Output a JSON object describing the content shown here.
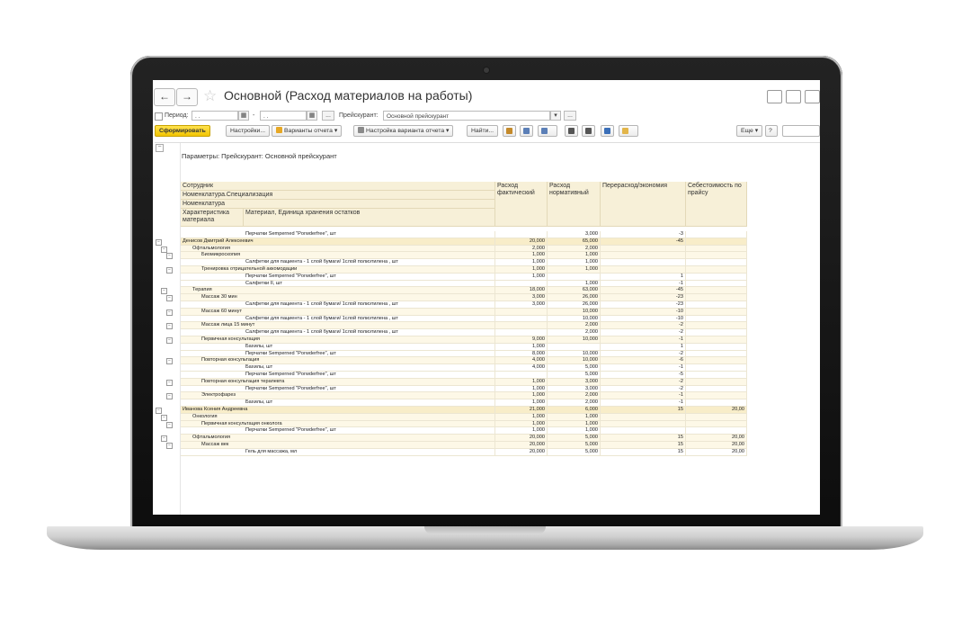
{
  "window": {
    "title": "Основной (Расход материалов на работы)",
    "back_label": "←",
    "forward_label": "→"
  },
  "filters": {
    "period_label": "Период:",
    "date_from": "  .  .",
    "date_to": "  .  .",
    "dash": "-",
    "more_button": "...",
    "pricelist_label": "Прейскурант:",
    "pricelist_value": "Основной прейскурант",
    "pricelist_dropdown": "▾",
    "pricelist_more": "..."
  },
  "toolbar": {
    "generate": "Сформировать",
    "settings": "Настройки...",
    "variants": "Варианты отчета",
    "variant_settings": "Настройка варианта отчета",
    "find": "Найти...",
    "more": "Еще",
    "help": "?"
  },
  "report": {
    "params_text": "Параметры:   Прейскурант: Основной прейскурант",
    "headers": {
      "employee": "Сотрудник",
      "specialization": "Номенклатура.Специализация",
      "nomenclature": "Номенклатура",
      "characteristic": "Характеристика материала",
      "material": "Материал, Единица хранения остатков",
      "actual": "Расход фактический",
      "normative": "Расход нормативный",
      "variance": "Перерасход/экономия",
      "cost": "Себестоимость по прайсу"
    },
    "rows": [
      {
        "level": 3,
        "name": "Перчатки Semperned \"Porwderfree\", шт",
        "actual": "",
        "normative": "3,000",
        "variance": "-3",
        "cost": ""
      },
      {
        "level": 0,
        "name": "Денисов Дмитрий Алексеевич",
        "actual": "20,000",
        "normative": "65,000",
        "variance": "-45",
        "cost": ""
      },
      {
        "level": 1,
        "name": "Офтальмология",
        "actual": "2,000",
        "normative": "2,000",
        "variance": "",
        "cost": ""
      },
      {
        "level": 2,
        "name": "Биомикроскопия",
        "actual": "1,000",
        "normative": "1,000",
        "variance": "",
        "cost": ""
      },
      {
        "level": 3,
        "name": "Салфетки для пациента - 1 слой бумаги/ 1слой полиэтилена , шт",
        "actual": "1,000",
        "normative": "1,000",
        "variance": "",
        "cost": ""
      },
      {
        "level": 2,
        "name": "Тренировка отрицательной аккомодации",
        "actual": "1,000",
        "normative": "1,000",
        "variance": "",
        "cost": ""
      },
      {
        "level": 3,
        "name": "Перчатки Semperned \"Porwderfree\", шт",
        "actual": "1,000",
        "normative": "",
        "variance": "1",
        "cost": ""
      },
      {
        "level": 3,
        "name": "Салфетки II, шт",
        "actual": "",
        "normative": "1,000",
        "variance": "-1",
        "cost": ""
      },
      {
        "level": 1,
        "name": "Терапия",
        "actual": "18,000",
        "normative": "63,000",
        "variance": "-45",
        "cost": ""
      },
      {
        "level": 2,
        "name": "Массаж 30 мин",
        "actual": "3,000",
        "normative": "26,000",
        "variance": "-23",
        "cost": ""
      },
      {
        "level": 3,
        "name": "Салфетки для пациента - 1 слой бумаги/ 1слой полиэтилена , шт",
        "actual": "3,000",
        "normative": "26,000",
        "variance": "-23",
        "cost": ""
      },
      {
        "level": 2,
        "name": "Массаж 60 минут",
        "actual": "",
        "normative": "10,000",
        "variance": "-10",
        "cost": ""
      },
      {
        "level": 3,
        "name": "Салфетки для пациента - 1 слой бумаги/ 1слой полиэтилена , шт",
        "actual": "",
        "normative": "10,000",
        "variance": "-10",
        "cost": ""
      },
      {
        "level": 2,
        "name": "Массаж лица 15 минут",
        "actual": "",
        "normative": "2,000",
        "variance": "-2",
        "cost": ""
      },
      {
        "level": 3,
        "name": "Салфетки для пациента - 1 слой бумаги/ 1слой полиэтилена , шт",
        "actual": "",
        "normative": "2,000",
        "variance": "-2",
        "cost": ""
      },
      {
        "level": 2,
        "name": "Первичная консультация",
        "actual": "9,000",
        "normative": "10,000",
        "variance": "-1",
        "cost": ""
      },
      {
        "level": 3,
        "name": "Бахилы, шт",
        "actual": "1,000",
        "normative": "",
        "variance": "1",
        "cost": ""
      },
      {
        "level": 3,
        "name": "Перчатки Semperned \"Porwderfree\", шт",
        "actual": "8,000",
        "normative": "10,000",
        "variance": "-2",
        "cost": ""
      },
      {
        "level": 2,
        "name": "Повторная консультация",
        "actual": "4,000",
        "normative": "10,000",
        "variance": "-6",
        "cost": ""
      },
      {
        "level": 3,
        "name": "Бахилы, шт",
        "actual": "4,000",
        "normative": "5,000",
        "variance": "-1",
        "cost": ""
      },
      {
        "level": 3,
        "name": "Перчатки Semperned \"Porwderfree\", шт",
        "actual": "",
        "normative": "5,000",
        "variance": "-5",
        "cost": ""
      },
      {
        "level": 2,
        "name": "Повторная консультация терапевта",
        "actual": "1,000",
        "normative": "3,000",
        "variance": "-2",
        "cost": ""
      },
      {
        "level": 3,
        "name": "Перчатки Semperned \"Porwderfree\", шт",
        "actual": "1,000",
        "normative": "3,000",
        "variance": "-2",
        "cost": ""
      },
      {
        "level": 2,
        "name": "Электрофарез",
        "actual": "1,000",
        "normative": "2,000",
        "variance": "-1",
        "cost": ""
      },
      {
        "level": 3,
        "name": "Бахилы, шт",
        "actual": "1,000",
        "normative": "2,000",
        "variance": "-1",
        "cost": ""
      },
      {
        "level": 0,
        "name": "Иванова Ксения Андреевна",
        "actual": "21,000",
        "normative": "6,000",
        "variance": "15",
        "cost": "20,00"
      },
      {
        "level": 1,
        "name": "Онкология",
        "actual": "1,000",
        "normative": "1,000",
        "variance": "",
        "cost": ""
      },
      {
        "level": 2,
        "name": "Первичная консультация онколога",
        "actual": "1,000",
        "normative": "1,000",
        "variance": "",
        "cost": ""
      },
      {
        "level": 3,
        "name": "Перчатки Semperned \"Porwderfree\", шт",
        "actual": "1,000",
        "normative": "1,000",
        "variance": "",
        "cost": ""
      },
      {
        "level": 1,
        "name": "Офтальмология",
        "actual": "20,000",
        "normative": "5,000",
        "variance": "15",
        "cost": "20,00"
      },
      {
        "level": 2,
        "name": "Массаж век",
        "actual": "20,000",
        "normative": "5,000",
        "variance": "15",
        "cost": "20,00"
      },
      {
        "level": 3,
        "name": "Гель для массажа, мл",
        "actual": "20,000",
        "normative": "5,000",
        "variance": "15",
        "cost": "20,00"
      }
    ]
  }
}
